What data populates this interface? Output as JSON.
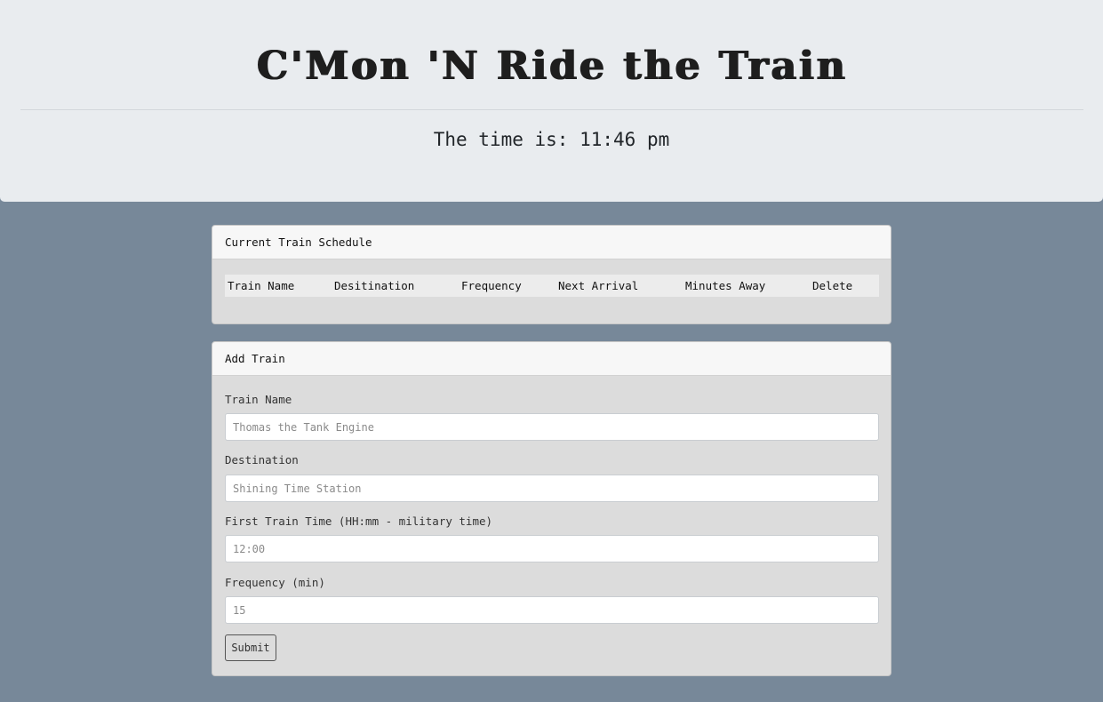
{
  "header": {
    "title": "C'Mon 'N Ride the Train",
    "clock_prefix": "The time is:",
    "clock_time": "11:46 pm",
    "clock_text": "The time is: 11:46 pm"
  },
  "schedule": {
    "heading": "Current Train Schedule",
    "columns": [
      "Train Name",
      "Desitination",
      "Frequency",
      "Next Arrival",
      "Minutes Away",
      "Delete"
    ]
  },
  "add_train": {
    "heading": "Add Train",
    "fields": {
      "name": {
        "label": "Train Name",
        "placeholder": "Thomas the Tank Engine"
      },
      "destination": {
        "label": "Destination",
        "placeholder": "Shining Time Station"
      },
      "first_time": {
        "label": "First Train Time (HH:mm - military time)",
        "placeholder": "12:00"
      },
      "frequency": {
        "label": "Frequency (min)",
        "placeholder": "15"
      }
    },
    "submit_label": "Submit"
  },
  "colors": {
    "page_background": "#778899",
    "jumbotron_background": "#e9ecef",
    "card_background": "#dcdcdc",
    "card_header_background": "#f7f7f7"
  }
}
